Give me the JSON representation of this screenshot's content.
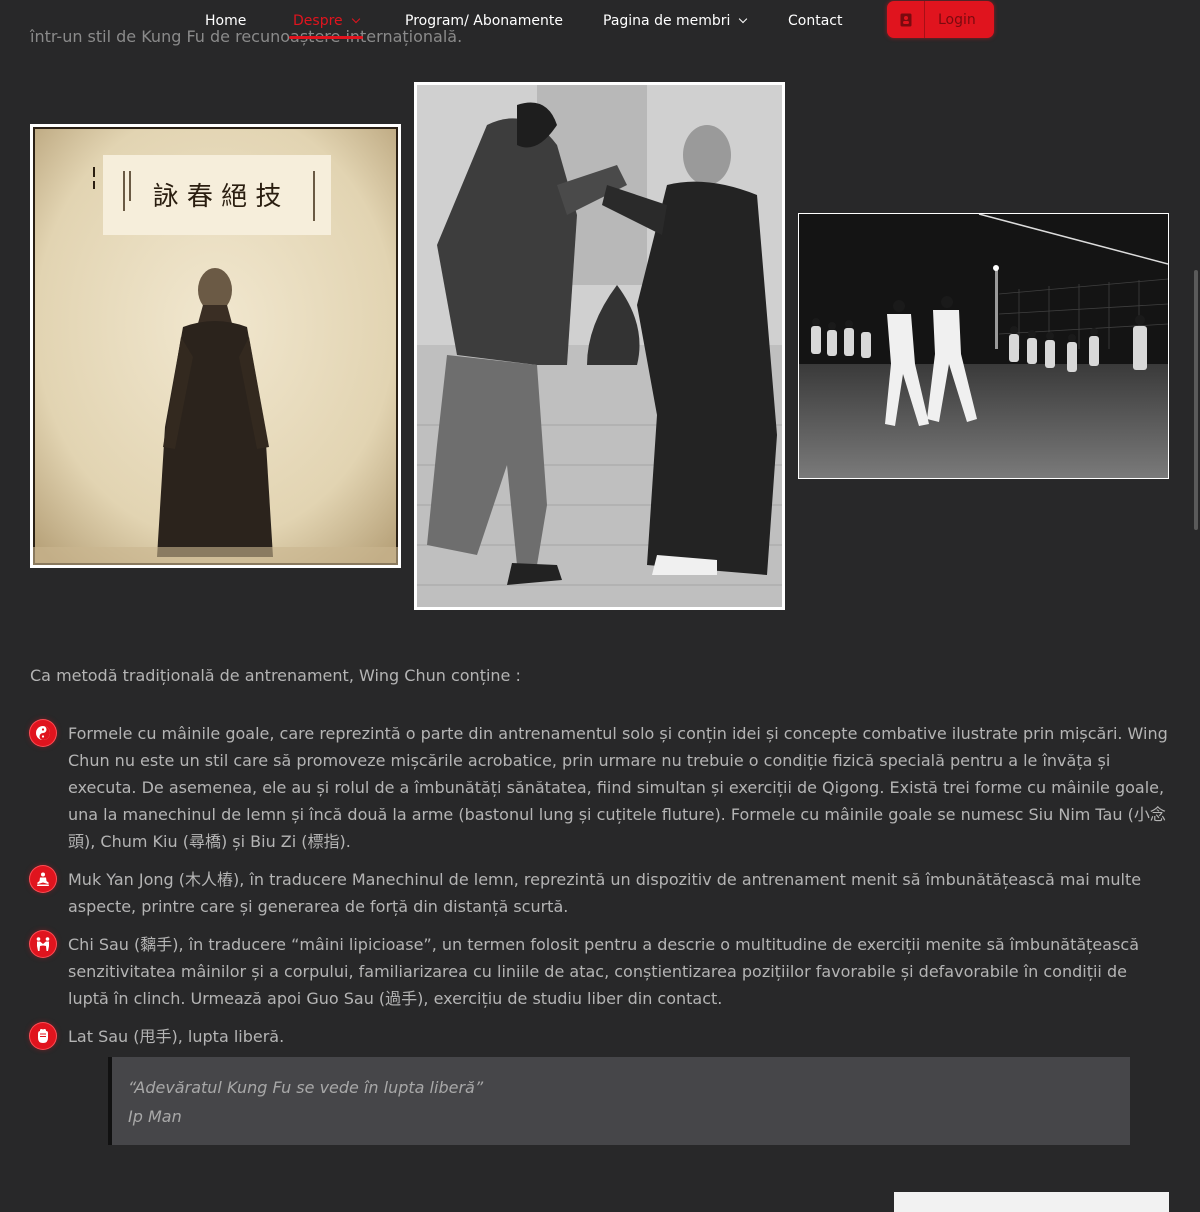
{
  "nav": {
    "items": [
      {
        "label": "Home"
      },
      {
        "label": "Despre"
      },
      {
        "label": "Program/ Abonamente"
      },
      {
        "label": "Pagina de membri"
      },
      {
        "label": "Contact"
      }
    ],
    "login_label": "Login"
  },
  "intro_text": "într-un stil de Kung Fu de recunoaștere internațională.",
  "photos": {
    "photo1_calligraphy": "詠 春 絕 技"
  },
  "lead": "Ca metodă tradițională de antrenament, Wing Chun conține :",
  "list": [
    {
      "icon": "yin-yang-icon",
      "text": "Formele cu mâinile goale, care reprezintă o parte din antrenamentul solo și conțin idei și concepte combative ilustrate prin mișcări. Wing Chun nu este un stil care să promoveze mișcările acrobatice, prin urmare nu trebuie o condiție fizică specială pentru a le învăța și executa. De asemenea, ele au și rolul de a îmbunătăți sănătatea, fiind simultan și exerciții de Qigong. Există trei forme cu mâinile goale, una la manechinul de lemn și încă două la arme (bastonul lung și cuțitele fluture). Formele cu mâinile goale se numesc Siu Nim Tau (小念頭), Chum Kiu (尋橋) și Biu Zi (標指)."
    },
    {
      "icon": "meditation-icon",
      "text": "Muk Yan Jong (木人樁), în traducere Manechinul de lemn, reprezintă un dispozitiv de antrenament menit să îmbunătățească mai multe aspecte, printre care și generarea de forță din distanță scurtă."
    },
    {
      "icon": "sparring-icon",
      "text": "Chi Sau (黐手), în traducere “mâini lipicioase”, un termen folosit pentru a descrie o multitudine de exerciții menite să îmbunătățească senzitivitatea mâinilor și a corpului, familiarizarea cu liniile de atac, conștientizarea pozițiilor favorabile și defavorabile în condiții de luptă în clinch. Urmează apoi Guo Sau (過手), exercițiu de studiu liber din contact."
    },
    {
      "icon": "fist-icon",
      "text": "Lat Sau (甩手), lupta liberă."
    }
  ],
  "quote": {
    "text": "“Adevăratul Kung Fu se vede în lupta liberă”",
    "author": "Ip Man"
  },
  "colors": {
    "background": "#282829",
    "accent": "#e0141e",
    "text": "#b4b4b4",
    "quote_bg": "#464649"
  }
}
